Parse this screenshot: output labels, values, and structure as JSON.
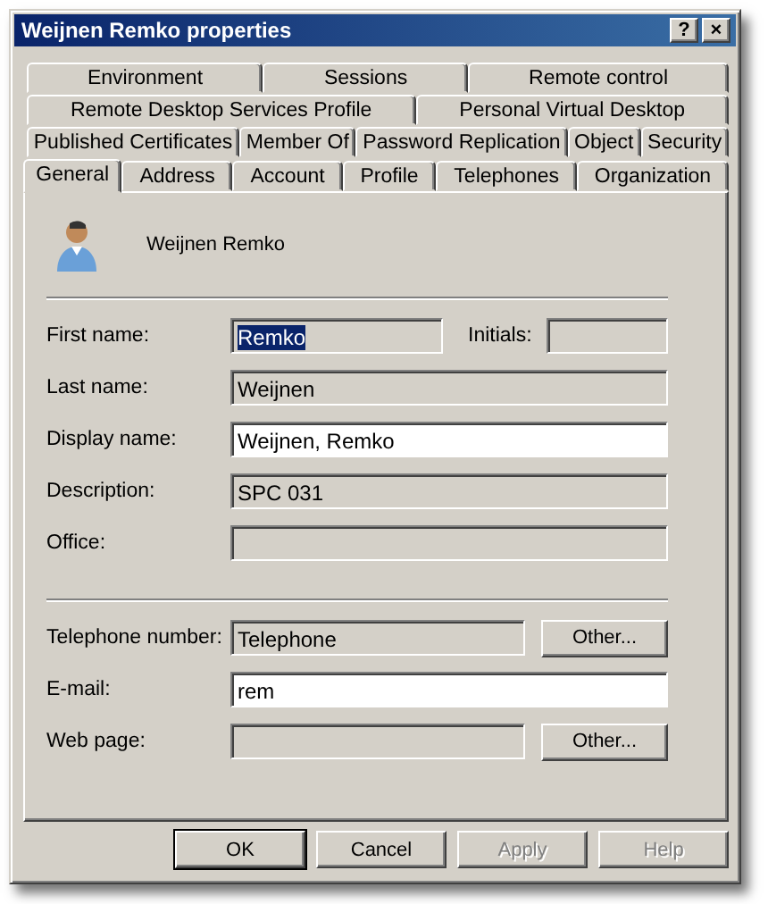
{
  "window": {
    "title": "Weijnen Remko properties",
    "controls": [
      "?",
      "×"
    ]
  },
  "tab_rows": [
    [
      {
        "label": "Environment",
        "selected": false
      },
      {
        "label": "Sessions",
        "selected": false
      },
      {
        "label": "Remote control",
        "selected": false
      }
    ],
    [
      {
        "label": "Remote Desktop Services Profile",
        "selected": false
      },
      {
        "label": "Personal Virtual Desktop",
        "selected": false
      }
    ],
    [
      {
        "label": "Published Certificates",
        "selected": false
      },
      {
        "label": "Member Of",
        "selected": false
      },
      {
        "label": "Password Replication",
        "selected": false
      },
      {
        "label": "Object",
        "selected": false
      },
      {
        "label": "Security",
        "selected": false
      }
    ],
    [
      {
        "label": "General",
        "selected": true
      },
      {
        "label": "Address",
        "selected": false
      },
      {
        "label": "Account",
        "selected": false
      },
      {
        "label": "Profile",
        "selected": false
      },
      {
        "label": "Telephones",
        "selected": false
      },
      {
        "label": "Organization",
        "selected": false
      }
    ]
  ],
  "user": {
    "name": "Weijnen Remko"
  },
  "sections": [
    [
      {
        "label": "First name:",
        "value": "Remko",
        "editable": false,
        "highlighted": true,
        "side": {
          "label": "Initials:",
          "editable": false
        }
      },
      {
        "label": "Last name:",
        "value": "Weijnen",
        "editable": false,
        "highlighted": false
      },
      {
        "label": "Display name:",
        "value": "Weijnen, Remko",
        "editable": true,
        "highlighted": false
      },
      {
        "label": "Description:",
        "value": "SPC 031",
        "editable": false,
        "highlighted": false
      },
      {
        "label": "Office:",
        "editable": false
      }
    ],
    [
      {
        "label": "Telephone number:",
        "value": "Telephone",
        "editable": false,
        "highlighted": false,
        "button": "Other..."
      },
      {
        "label": "E-mail:",
        "value": "rem",
        "editable": true,
        "highlighted": false
      },
      {
        "label": "Web page:",
        "editable": false,
        "button": "Other..."
      }
    ]
  ],
  "buttons": [
    {
      "label": "OK",
      "default": true,
      "disabled": false
    },
    {
      "label": "Cancel",
      "default": false,
      "disabled": false
    },
    {
      "label": "Apply",
      "default": false,
      "disabled": true
    },
    {
      "label": "Help",
      "default": false,
      "disabled": true
    }
  ]
}
